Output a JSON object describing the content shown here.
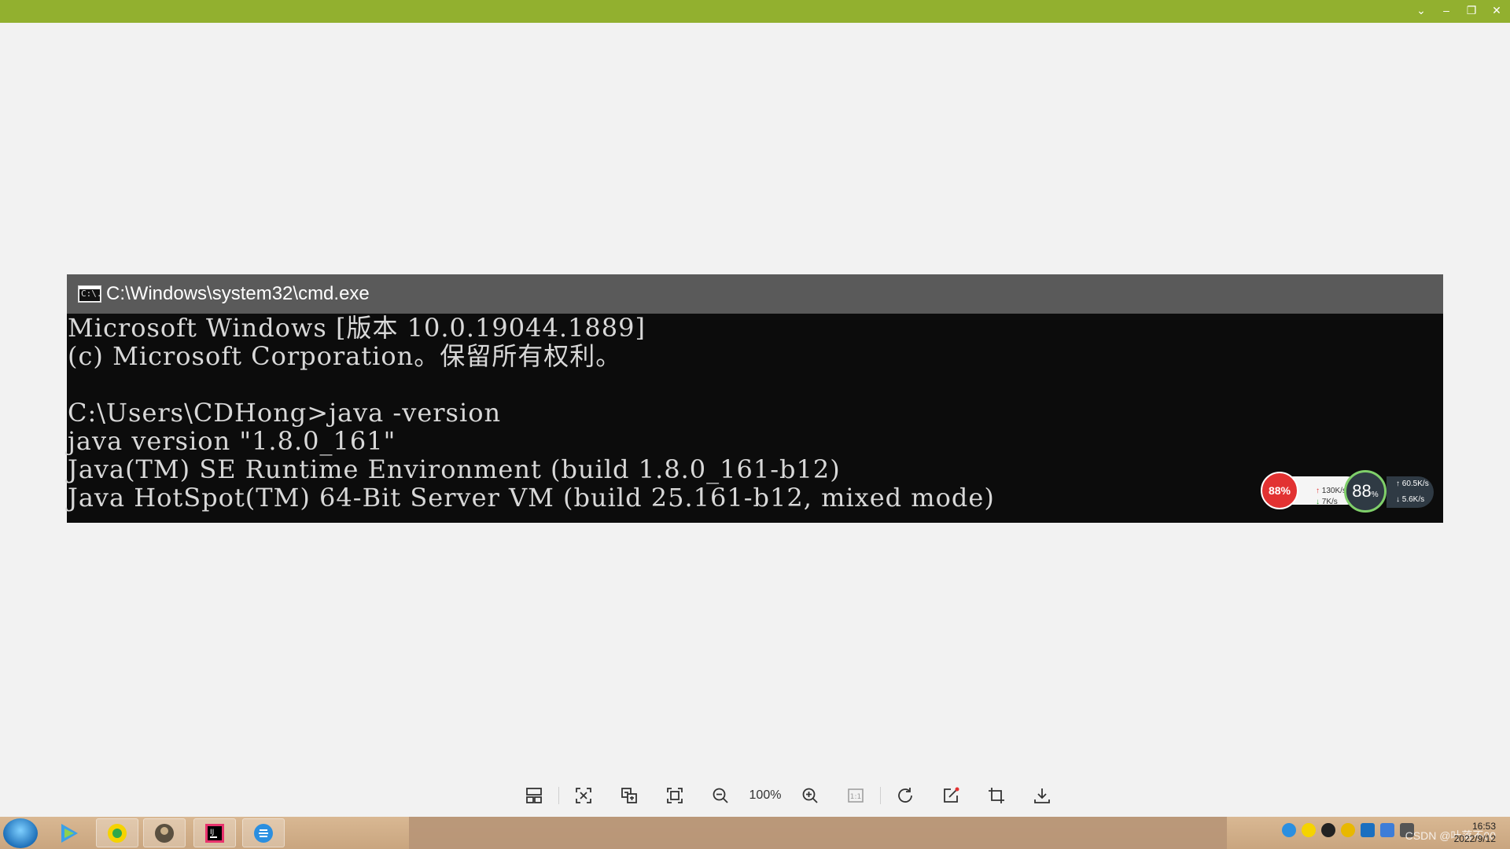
{
  "cmd": {
    "title": "C:\\Windows\\system32\\cmd.exe",
    "icon_text": "C:\\.",
    "lines": [
      "Microsoft Windows [版本 10.0.19044.1889]",
      "(c) Microsoft Corporation。保留所有权利。",
      "",
      "C:\\Users\\CDHong>java -version",
      "java version \"1.8.0_161\"",
      "Java(TM) SE Runtime Environment (build 1.8.0_161-b12)",
      "Java HotSpot(TM) 64-Bit Server VM (build 25.161-b12, mixed mode)"
    ]
  },
  "monitor": {
    "cpu_percent": "88%",
    "up_speed": "130K/s",
    "down_speed": "7K/s",
    "ring_value": "88",
    "ring_unit": "%",
    "speed_up": "60.5K/s",
    "speed_down": "5.6K/s"
  },
  "toolbar": {
    "zoom_label": "100%",
    "icons": [
      "layout-icon",
      "fit-window-icon",
      "translate-icon",
      "fullscreen-icon",
      "zoom-out-icon",
      "zoom-in-icon",
      "actual-size-icon",
      "rotate-icon",
      "edit-icon",
      "crop-icon",
      "download-icon"
    ],
    "actual_size_label": "1:1"
  },
  "taskbar": {
    "clock_time": "16:53",
    "clock_date": "2022/9/12",
    "watermark": "CSDN @叶落不00"
  },
  "colors": {
    "topbar": "#92b02f",
    "viewer_bg": "#f2f2f2",
    "cmd_bg": "#0c0c0c",
    "cmd_title": "#5a5a5a",
    "cmd_text": "#d8d8d8"
  }
}
